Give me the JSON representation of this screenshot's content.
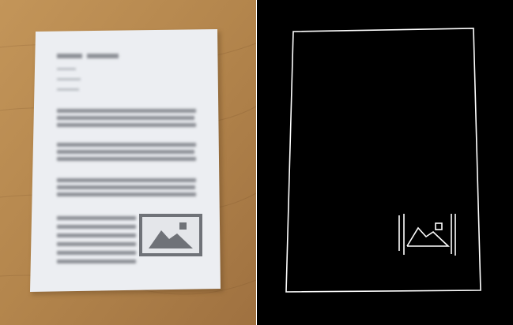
{
  "panels": [
    {
      "name": "photo",
      "description_visible": false
    },
    {
      "name": "edge-map",
      "description_visible": false
    }
  ],
  "colors": {
    "desk": "#b88a52",
    "desk_dark": "#a5773f",
    "paper": "#eceef2",
    "text_blur": "#8c8f95",
    "image_frame": "#6f7278",
    "edge_line": "#ffffff",
    "edge_bg": "#000000"
  },
  "document": {
    "paragraph_count": 4,
    "has_image_placeholder": true
  },
  "icons": [
    "image-placeholder-icon"
  ]
}
